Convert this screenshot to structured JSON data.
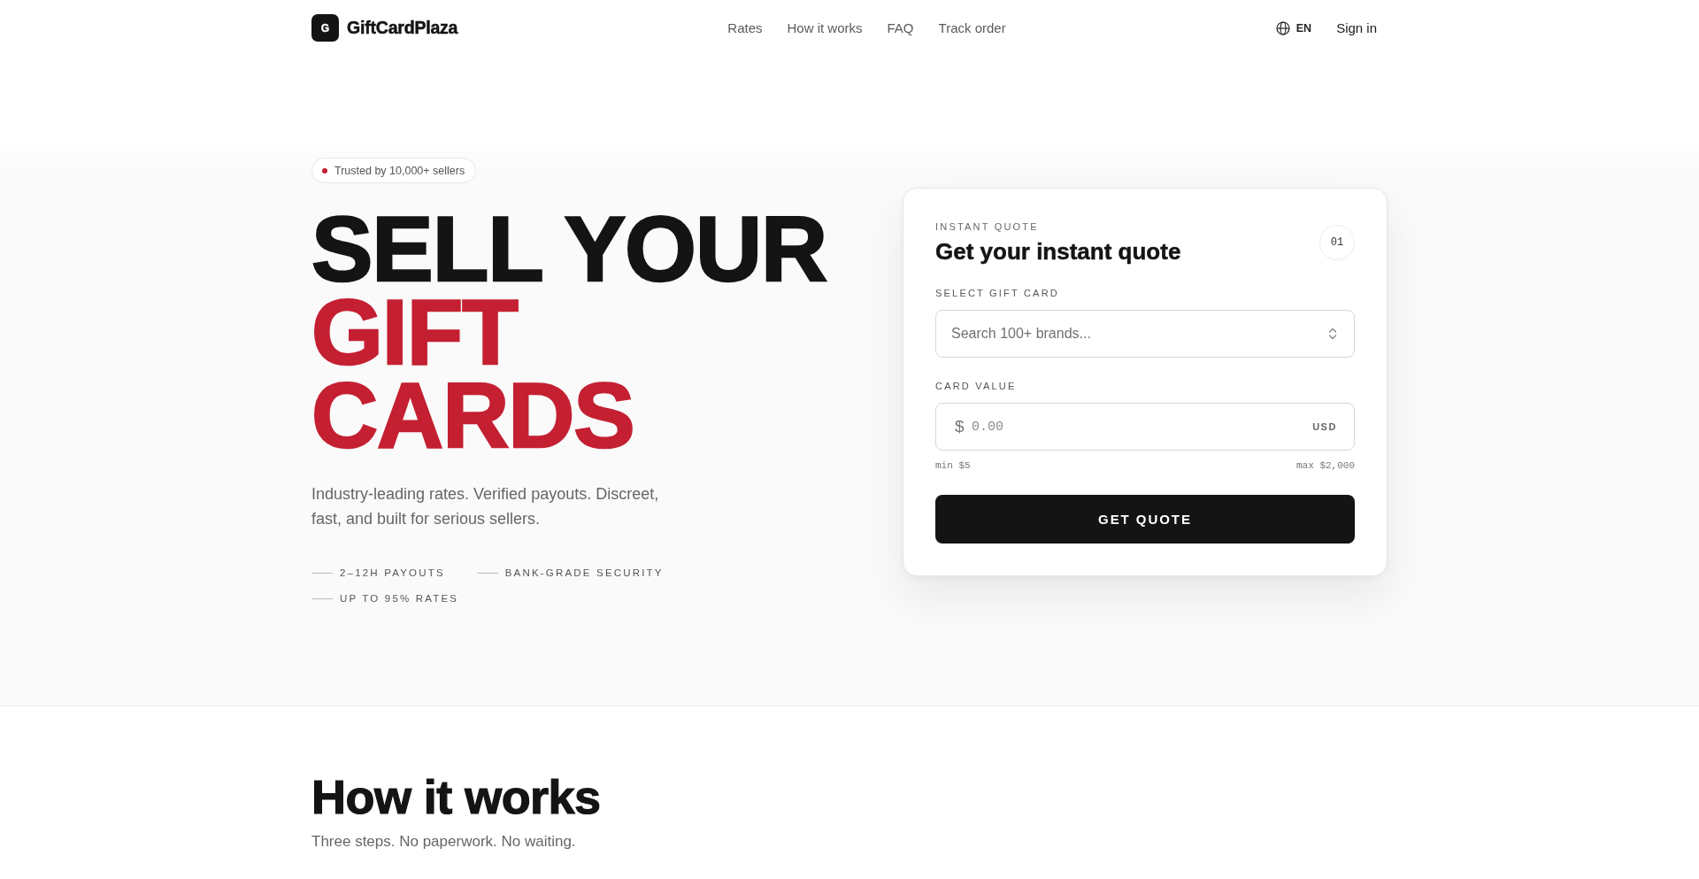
{
  "header": {
    "logo": {
      "mark": "G",
      "name": "GiftCardPlaza"
    },
    "nav": [
      {
        "label": "Rates"
      },
      {
        "label": "How it works"
      },
      {
        "label": "FAQ"
      },
      {
        "label": "Track order"
      }
    ],
    "language": "EN",
    "sign_in": "Sign in"
  },
  "hero": {
    "badge": "Trusted by 10,000+ sellers",
    "headline": [
      {
        "text": "SELL YOUR",
        "accent": false
      },
      {
        "text": "GIFT CARDS",
        "accent": true
      }
    ],
    "description": "Industry-leading rates. Verified payouts. Discreet, fast, and built for serious sellers.",
    "features": [
      "2–12H PAYOUTS",
      "BANK-GRADE SECURITY",
      "UP TO 95% RATES"
    ]
  },
  "quote_card": {
    "eyebrow": "INSTANT QUOTE",
    "title": "Get your instant quote",
    "step": "01",
    "fields": [
      {
        "kind": "select",
        "label": "SELECT GIFT CARD",
        "placeholder": "Search 100+ brands..."
      },
      {
        "kind": "amount",
        "label": "CARD VALUE",
        "prefix": "$",
        "placeholder": "0.00",
        "suffix": "USD",
        "hints": [
          "min $5",
          "max $2,000"
        ]
      }
    ],
    "button": "GET QUOTE"
  },
  "how_it_works": {
    "title": "How it works",
    "subtitle": "Three steps. No paperwork. No waiting."
  }
}
